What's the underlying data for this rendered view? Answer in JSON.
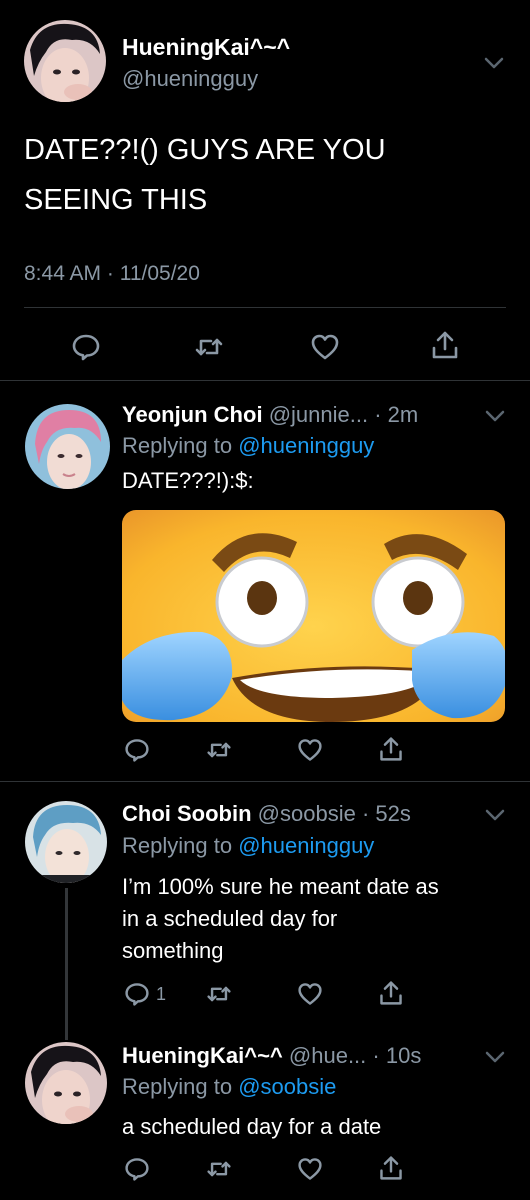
{
  "main_tweet": {
    "display_name": "HueningKai^~^",
    "handle": "@hueningguy",
    "text_line1": "DATE??!() GUYS ARE YOU",
    "text_line2": "SEEING THIS",
    "timestamp": "8:44 AM · 11/05/20"
  },
  "replies": [
    {
      "display_name": "Yeonjun Choi",
      "handle": "@junnie...",
      "time": "· 2m",
      "replying_prefix": "Replying to",
      "replying_to": "@hueningguy",
      "text": "DATE???!):$:"
    },
    {
      "display_name": "Choi Soobin",
      "handle": "@soobsie",
      "time": "· 52s",
      "replying_prefix": "Replying to",
      "replying_to": "@hueningguy",
      "text_line1": "I’m 100% sure he meant date as",
      "text_line2": "in a scheduled day for",
      "text_line3": "something",
      "reply_count": "1"
    },
    {
      "display_name": "HueningKai^~^",
      "handle": "@hue...",
      "time": "· 10s",
      "replying_prefix": "Replying to",
      "replying_to": "@soobsie",
      "text": "a scheduled day for a date"
    }
  ],
  "colors": {
    "background": "#000000",
    "text": "#ffffff",
    "secondary": "#8b98a5",
    "link": "#1d9bf0",
    "divider": "#2f3336"
  }
}
